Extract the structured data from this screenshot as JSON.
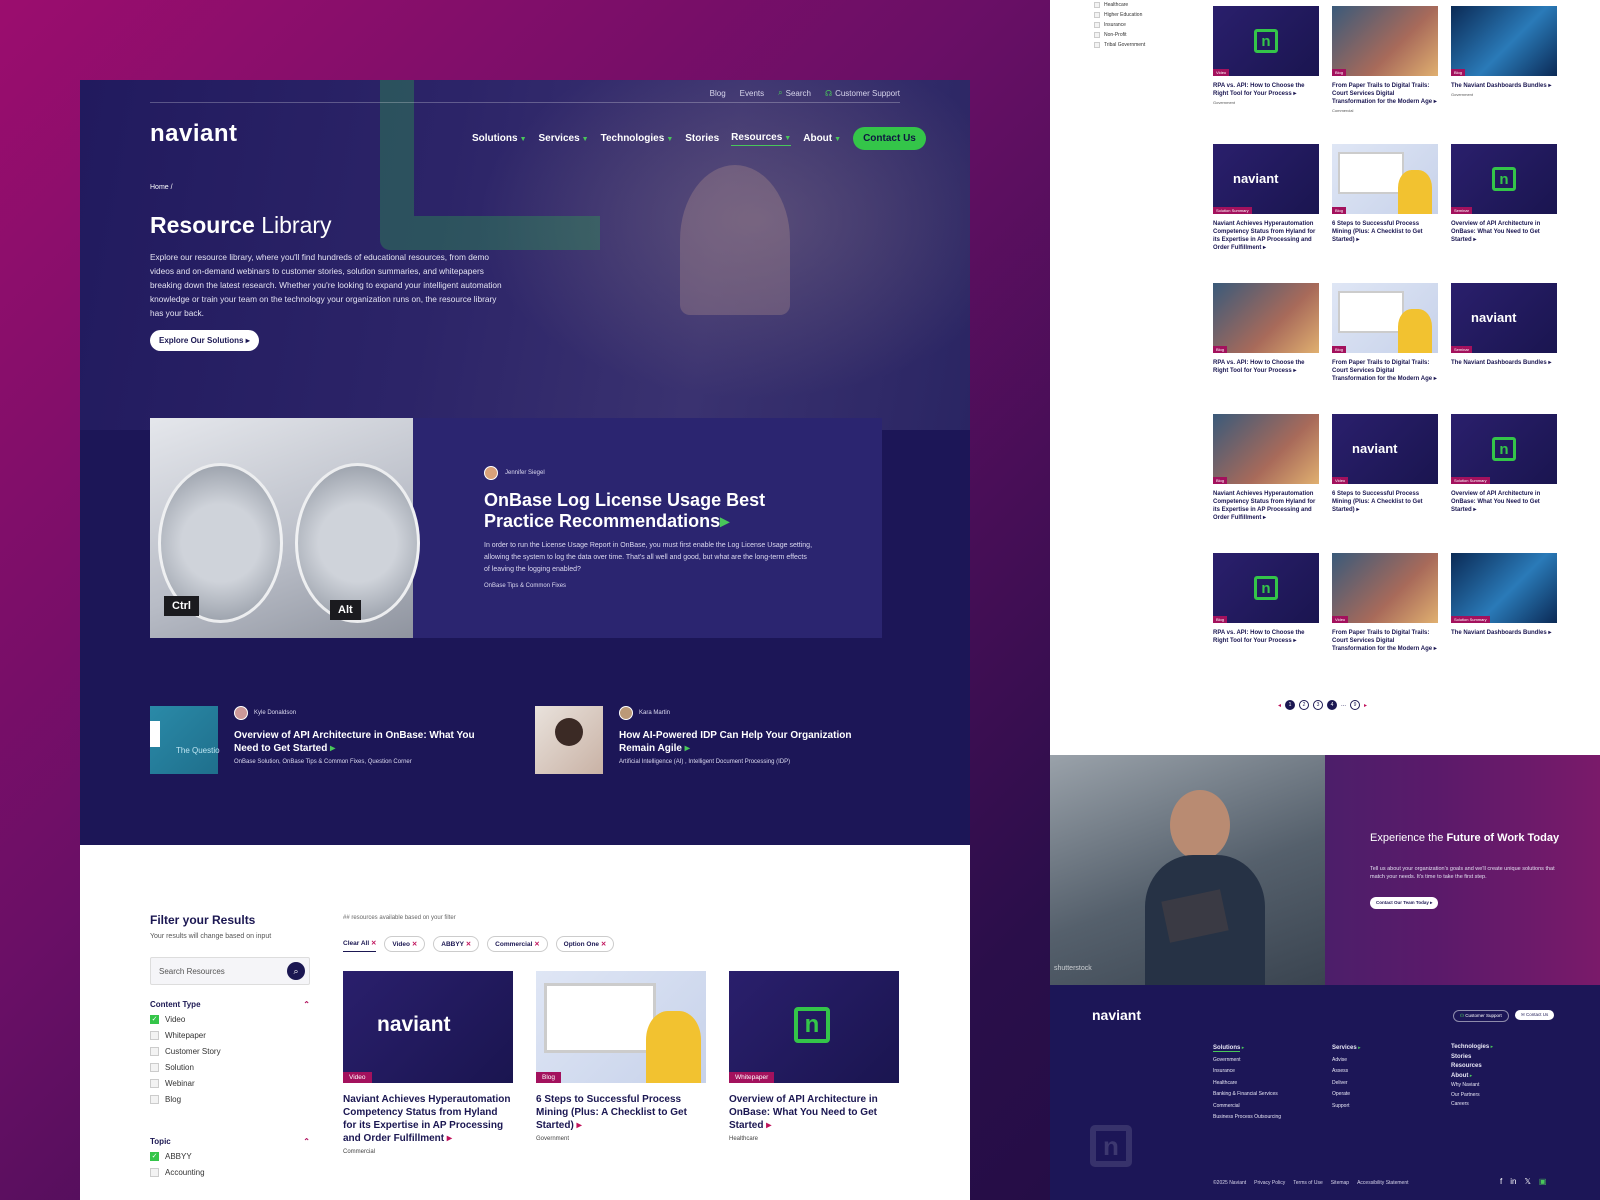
{
  "brand": {
    "logo_text": "naviant",
    "accent": "#34c549",
    "tag_color": "#a3115d",
    "navy": "#1c1657"
  },
  "utility_nav": {
    "blog": "Blog",
    "events": "Events",
    "search": "Search",
    "support": "Customer Support"
  },
  "main_nav": {
    "solutions": "Solutions",
    "services": "Services",
    "technologies": "Technologies",
    "stories": "Stories",
    "resources": "Resources",
    "about": "About",
    "contact": "Contact Us"
  },
  "hero": {
    "breadcrumb": "Home /",
    "title_bold": "Resource",
    "title_rest": " Library",
    "description": "Explore our resource library, where you'll find hundreds of educational resources, from demo videos and on-demand webinars to customer stories, solution summaries, and whitepapers breaking down the latest research. Whether you're looking to expand your intelligent automation knowledge or train your team on the technology your organization runs on, the resource library has your back.",
    "cta": "Explore Our Solutions"
  },
  "featured": {
    "author": "Jennifer Siegel",
    "title": "OnBase Log License Usage Best Practice Recommendations",
    "description": "In order to run the License Usage Report in OnBase, you must first enable the Log License Usage setting, allowing the system to log the data over time. That's all well and good, but what are the long-term effects of leaving the logging enabled?",
    "category": "OnBase Tips & Common Fixes",
    "key_left": "Ctrl",
    "key_right": "Alt"
  },
  "stories": [
    {
      "author": "Kyle Donaldson",
      "title": "Overview of API Architecture in OnBase: What You Need to Get Started",
      "tags": "OnBase Solution, OnBase Tips & Common Fixes, Question Corner",
      "thumb_text": "The Questio"
    },
    {
      "author": "Kara Martin",
      "title": "How AI-Powered IDP Can Help Your Organization Remain Agile",
      "tags": "Artificial Intelligence (AI) , Intelligent Document Processing (IDP)"
    }
  ],
  "filter": {
    "title": "Filter your Results",
    "subtitle": "Your results will change based on input",
    "search_placeholder": "Search Resources",
    "content_type_label": "Content Type",
    "content_types": [
      {
        "label": "Video",
        "checked": true
      },
      {
        "label": "Whitepaper",
        "checked": false
      },
      {
        "label": "Customer Story",
        "checked": false
      },
      {
        "label": "Solution",
        "checked": false
      },
      {
        "label": "Webinar",
        "checked": false
      },
      {
        "label": "Blog",
        "checked": false
      }
    ],
    "topic_label": "Topic",
    "topics": [
      {
        "label": "ABBYY",
        "checked": true
      },
      {
        "label": "Accounting",
        "checked": false
      }
    ]
  },
  "results": {
    "count_text": "## resources available based on your filter",
    "chips": [
      "Clear All",
      "Video",
      "ABBYY",
      "Commercial",
      "Option One"
    ],
    "cards": [
      {
        "tag": "Video",
        "title": "Naviant Achieves Hyperautomation Competency Status from Hyland for its Expertise in AP Processing and Order Fulfillment",
        "meta": "Commercial"
      },
      {
        "tag": "Blog",
        "title": "6 Steps to Successful Process Mining (Plus: A Checklist to Get Started)",
        "meta": "Government"
      },
      {
        "tag": "Whitepaper",
        "title": "Overview of API Architecture in OnBase: What You Need to Get Started",
        "meta": "Healthcare"
      }
    ]
  },
  "right_filters": [
    "Healthcare",
    "Higher Education",
    "Insurance",
    "Non-Profit",
    "Tribal Government"
  ],
  "right_grid": [
    {
      "tag": "Video",
      "title": "RPA vs. API: How to Choose the Right Tool for Your Process",
      "meta": "Government",
      "img": "n"
    },
    {
      "tag": "Blog",
      "title": "From Paper Trails to Digital Trails: Court Services Digital Transformation for the Modern Age",
      "meta": "Commercial",
      "img": "photo"
    },
    {
      "tag": "Blog",
      "title": "The Naviant Dashboards Bundles",
      "meta": "Government",
      "img": "wave"
    },
    {
      "tag": "Solution Summary",
      "title": "Naviant Achieves Hyperautomation Competency Status from Hyland for its Expertise in AP Processing and Order Fulfillment",
      "meta": "",
      "img": "logo"
    },
    {
      "tag": "Blog",
      "title": "6 Steps to Successful Process Mining (Plus: A Checklist to Get Started)",
      "meta": "",
      "img": "screen"
    },
    {
      "tag": "Seminar",
      "title": "Overview of API Architecture in OnBase: What You Need to Get Started",
      "meta": "",
      "img": "n"
    },
    {
      "tag": "Blog",
      "title": "RPA vs. API: How to Choose the Right Tool for Your Process",
      "meta": "",
      "img": "photo"
    },
    {
      "tag": "Blog",
      "title": "From Paper Trails to Digital Trails: Court Services Digital Transformation for the Modern Age",
      "meta": "",
      "img": "screen"
    },
    {
      "tag": "Seminar",
      "title": "The Naviant Dashboards Bundles",
      "meta": "",
      "img": "logo"
    },
    {
      "tag": "Blog",
      "title": "Naviant Achieves Hyperautomation Competency Status from Hyland for its Expertise in AP Processing and Order Fulfillment",
      "meta": "",
      "img": "photo"
    },
    {
      "tag": "Video",
      "title": "6 Steps to Successful Process Mining (Plus: A Checklist to Get Started)",
      "meta": "",
      "img": "logo"
    },
    {
      "tag": "Solution Summary",
      "title": "Overview of API Architecture in OnBase: What You Need to Get Started",
      "meta": "",
      "img": "n"
    },
    {
      "tag": "Blog",
      "title": "RPA vs. API: How to Choose the Right Tool for Your Process",
      "meta": "",
      "img": "n"
    },
    {
      "tag": "Video",
      "title": "From Paper Trails to Digital Trails: Court Services Digital Transformation for the Modern Age",
      "meta": "",
      "img": "photo"
    },
    {
      "tag": "Solution Summary",
      "title": "The Naviant Dashboards Bundles",
      "meta": "",
      "img": "wave"
    }
  ],
  "pagination": {
    "pages": [
      "1",
      "2",
      "3",
      "4",
      "...",
      "9"
    ],
    "current": 1
  },
  "cta_block": {
    "title_normal": "Experience the ",
    "title_bold": "Future of Work Today",
    "description": "Tell us about your organization's goals and we'll create unique solutions that match your needs. It's time to take the first step.",
    "button": "Contact Our Team Today",
    "watermark": "shutterstock"
  },
  "footer": {
    "support_btn": "Customer Support",
    "contact_btn": "Contact Us",
    "col1": {
      "heading": "Solutions",
      "items": [
        "Government",
        "Insurance",
        "Healthcare",
        "Banking & Financial Services",
        "Commercial",
        "Business Process Outsourcing"
      ]
    },
    "col2": {
      "heading": "Services",
      "items": [
        "Advise",
        "Assess",
        "Deliver",
        "Operate",
        "Support"
      ]
    },
    "col3": {
      "headings": [
        "Technologies",
        "Stories",
        "Resources",
        "About"
      ],
      "items": [
        "Why Naviant",
        "Our Partners",
        "Careers"
      ]
    },
    "legal": [
      "©2025 Naviant",
      "Privacy Policy",
      "Terms of Use",
      "Sitemap",
      "Accessibility Statement"
    ]
  }
}
